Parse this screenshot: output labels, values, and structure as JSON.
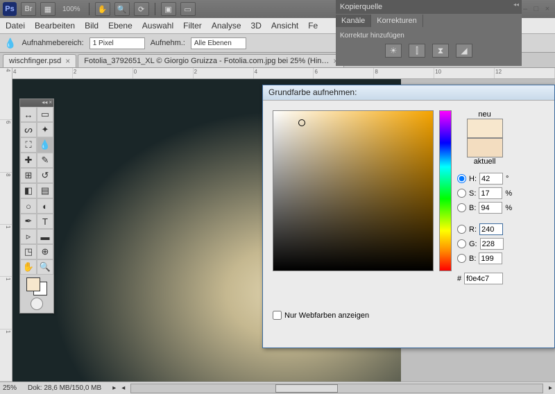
{
  "top": {
    "zoom": "100%"
  },
  "menu": [
    "Datei",
    "Bearbeiten",
    "Bild",
    "Ebene",
    "Auswahl",
    "Filter",
    "Analyse",
    "3D",
    "Ansicht",
    "Fe"
  ],
  "opts": {
    "label1": "Aufnahmebereich:",
    "val1": "1 Pixel",
    "label2": "Aufnehm.:",
    "val2": "Alle Ebenen"
  },
  "tabs": [
    {
      "label": "wischfinger.psd",
      "active": true
    },
    {
      "label": "Fotolia_3792651_XL © Giorgio Gruizza - Fotolia.com.jpg bei 25% (Hin…",
      "active": false
    }
  ],
  "ruler_v": [
    "4",
    "6",
    "8",
    "1",
    "1",
    "1"
  ],
  "ruler_h": [
    "4",
    "2",
    "0",
    "2",
    "4",
    "6",
    "8",
    "10",
    "12"
  ],
  "panel": {
    "title": "Kopierquelle",
    "tabs": [
      "Kanäle",
      "Korrekturen"
    ],
    "addLabel": "Korrektur hinzufügen"
  },
  "picker": {
    "title": "Grundfarbe aufnehmen:",
    "neu": "neu",
    "aktuell": "aktuell",
    "H": "42",
    "Hdeg": "°",
    "S": "17",
    "Spct": "%",
    "B": "94",
    "Bpct": "%",
    "R": "240",
    "G": "228",
    "Bl": "199",
    "hex": "f0e4c7",
    "webonly": "Nur Webfarben anzeigen"
  },
  "status": {
    "zoom": "25%",
    "doc": "Dok: 28,6 MB/150,0 MB"
  },
  "swatch": {
    "fg": "#f7e7cd",
    "bg": "#ffffff"
  }
}
